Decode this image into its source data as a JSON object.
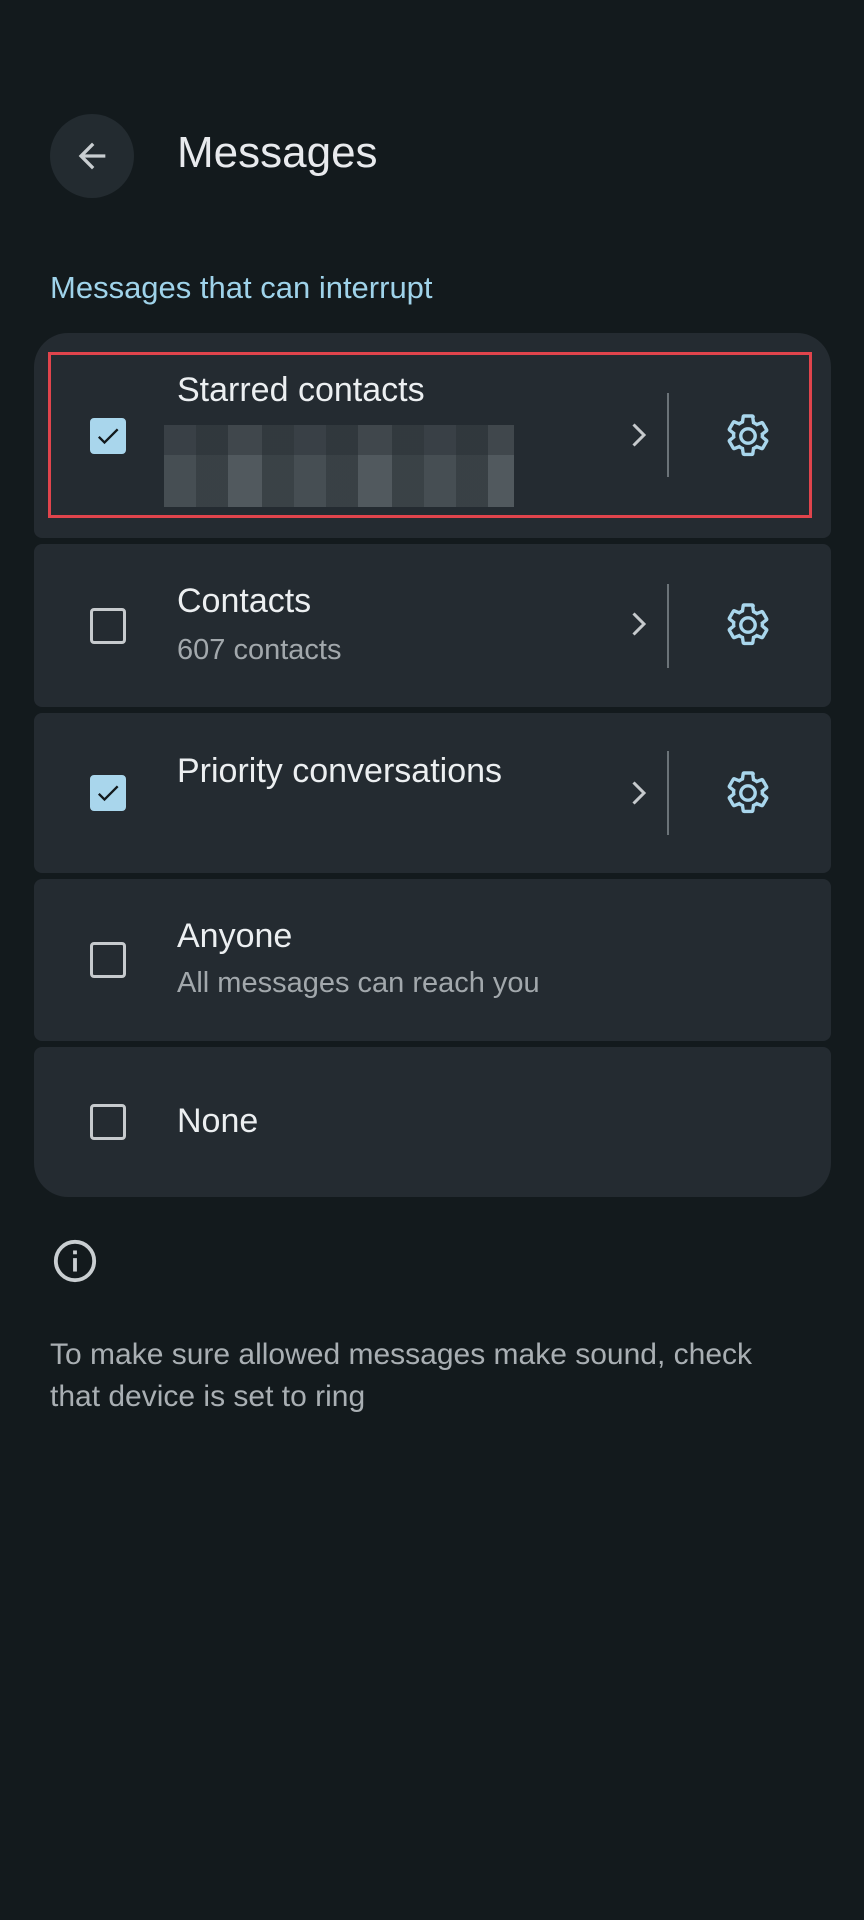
{
  "header": {
    "title": "Messages"
  },
  "section": {
    "heading": "Messages that can interrupt"
  },
  "items": [
    {
      "title": "Starred contacts",
      "subtitle": "",
      "checked": true
    },
    {
      "title": "Contacts",
      "subtitle": "607 contacts",
      "checked": false
    },
    {
      "title": "Priority conversations",
      "subtitle": "",
      "checked": true
    },
    {
      "title": "Anyone",
      "subtitle": "All messages can reach you",
      "checked": false
    },
    {
      "title": "None",
      "subtitle": "",
      "checked": false
    }
  ],
  "footer": {
    "note": "To make sure allowed messages make sound, check that device is set to ring"
  },
  "colors": {
    "background": "#131a1d",
    "card": "#242b31",
    "accent": "#9fd3ea",
    "highlight": "#e0444c"
  },
  "icons": [
    "back-arrow-icon",
    "checkbox-icon",
    "chevron-right-icon",
    "gear-icon",
    "info-icon"
  ]
}
